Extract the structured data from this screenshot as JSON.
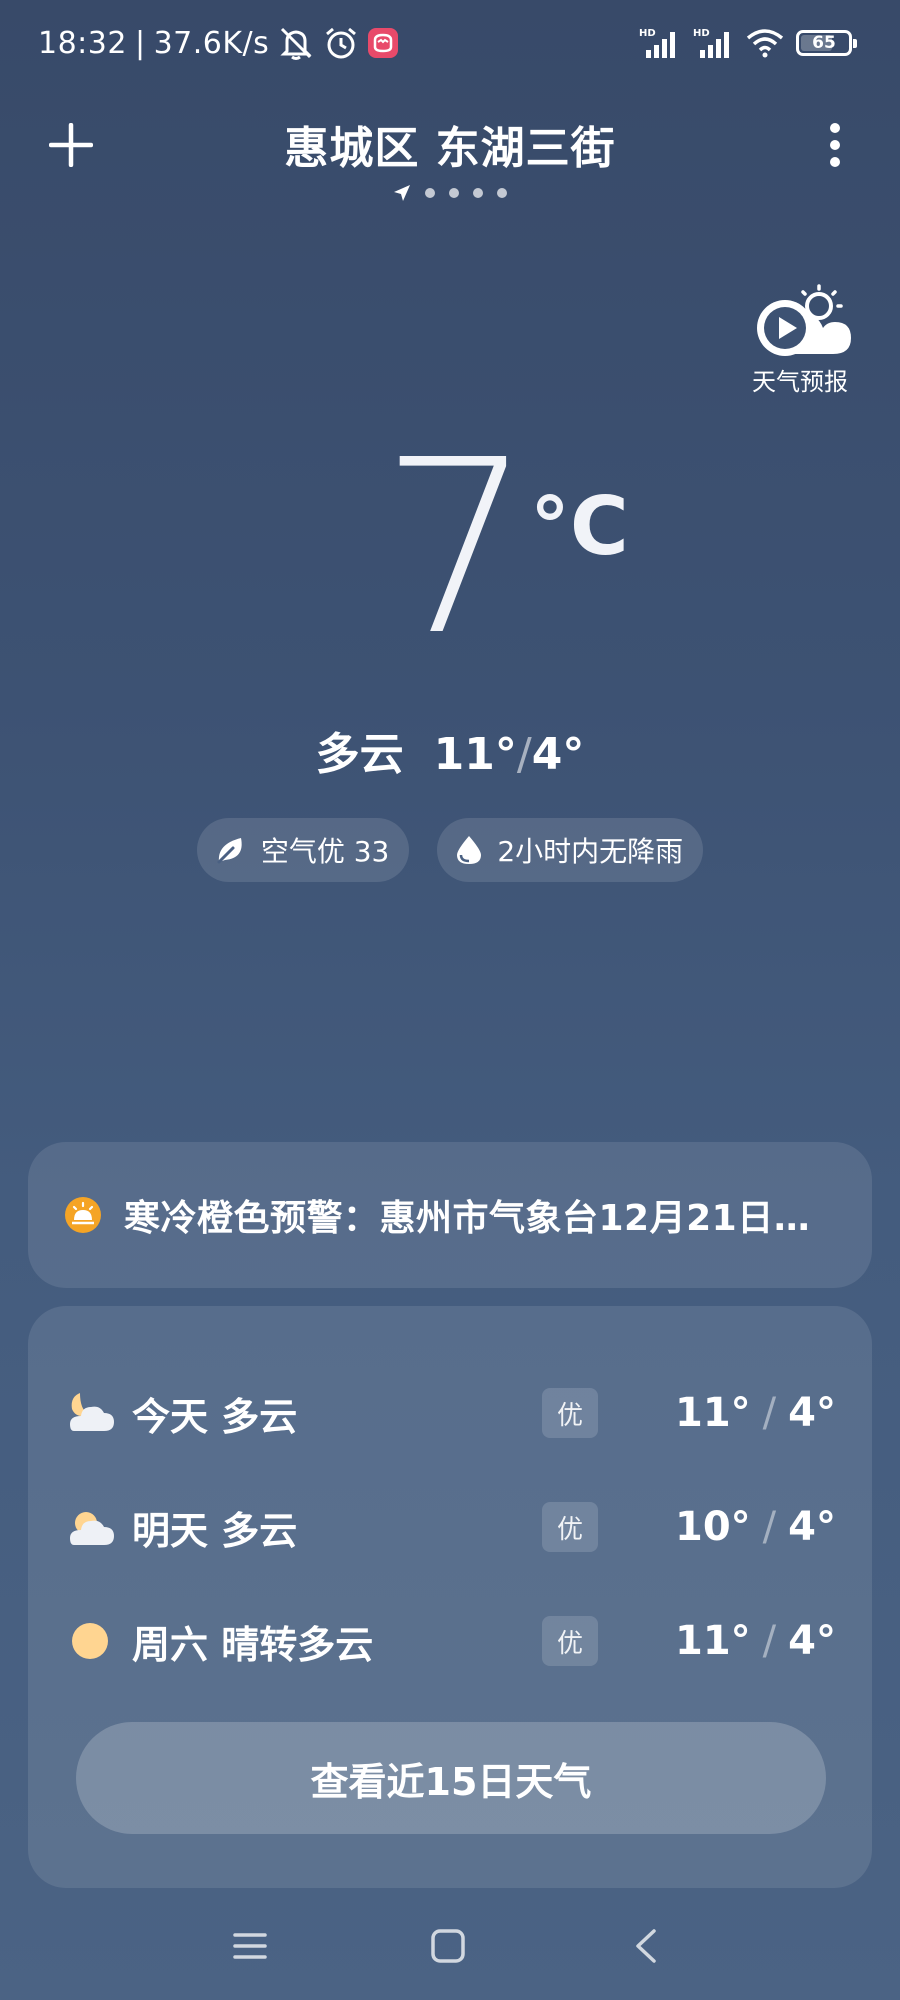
{
  "status_bar": {
    "time": "18:32",
    "separator": "|",
    "network_speed": "37.6K/s",
    "battery": 65,
    "sim1_label": "HD",
    "sim2_label": "HD"
  },
  "header": {
    "city": "惠城区 东湖三街",
    "pages": 5,
    "current_page": 0
  },
  "video_forecast": {
    "label": "天气预报"
  },
  "current": {
    "temperature": "7",
    "unit": "°C",
    "condition": "多云",
    "high": "11°",
    "slash": "/",
    "low": "4°"
  },
  "chips": {
    "air_quality": "空气优 33",
    "rain": "2小时内无降雨"
  },
  "alert": {
    "text": "寒冷橙色预警：惠州市气象台12月21日...",
    "color": "#f5a425"
  },
  "daily": [
    {
      "label": "今天  多云",
      "aqi": "优",
      "high": "11°",
      "low": "4°",
      "icon": "cloudy-night-icon"
    },
    {
      "label": "明天  多云",
      "aqi": "优",
      "high": "10°",
      "low": "4°",
      "icon": "cloudy-icon"
    },
    {
      "label": "周六  晴转多云",
      "aqi": "优",
      "high": "11°",
      "low": "4°",
      "icon": "sunny-icon"
    }
  ],
  "slash": "/",
  "fifteen_day_button": "查看近15日天气",
  "colors": {
    "background_top": "#384a69",
    "background_bottom": "#4b6384",
    "sun": "#ffd591",
    "alert": "#f5a425"
  }
}
